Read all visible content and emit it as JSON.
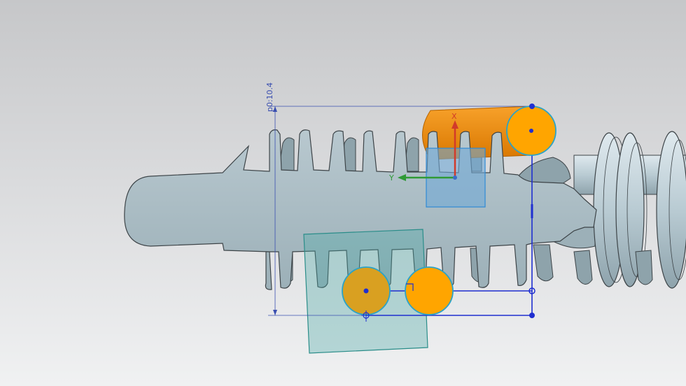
{
  "viewport": {
    "background_top": "#c6c7c9",
    "background_bottom": "#f0f1f2"
  },
  "dimension": {
    "label": "p0:10.4",
    "color": "#3a4fb0"
  },
  "csys": {
    "x_label": "X",
    "y_label": "Y",
    "x_color": "#d23a2a",
    "y_color": "#2f9a35",
    "z_color": "#3a6fc8"
  },
  "colors": {
    "part_body": "#a9bcc4",
    "part_edge": "#3d4448",
    "sketch_circle_fill": "#ffa500",
    "sketch_circle_edge": "#2aa3c8",
    "sketch_line": "#1f2fd0",
    "datum_plane": "#4aa9a6",
    "cylinder": "#f08c00"
  },
  "icons": {
    "constraint": "perpendicular-icon",
    "point": "sketch-point-icon"
  }
}
